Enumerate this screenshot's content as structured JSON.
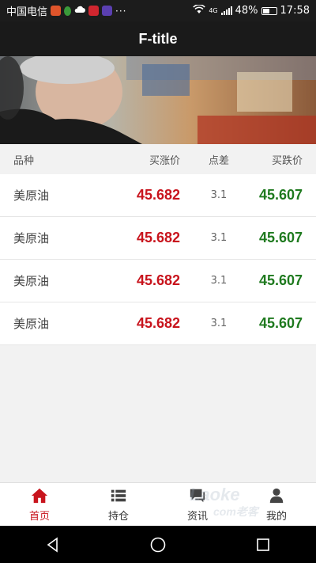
{
  "status_bar": {
    "carrier": "中国电信",
    "overflow_indicator": "···",
    "network": "4G",
    "battery": "48%",
    "battery_level": 0.48,
    "time": "17:58"
  },
  "header": {
    "title": "F-title"
  },
  "table": {
    "columns": [
      "品种",
      "买涨价",
      "点差",
      "买跌价"
    ],
    "rows": [
      {
        "name": "美原油",
        "buy": "45.682",
        "spread": "3.1",
        "sell": "45.607"
      },
      {
        "name": "美原油",
        "buy": "45.682",
        "spread": "3.1",
        "sell": "45.607"
      },
      {
        "name": "美原油",
        "buy": "45.682",
        "spread": "3.1",
        "sell": "45.607"
      },
      {
        "name": "美原油",
        "buy": "45.682",
        "spread": "3.1",
        "sell": "45.607"
      }
    ]
  },
  "tabs": [
    {
      "label": "首页",
      "icon": "home-icon",
      "active": true
    },
    {
      "label": "持仓",
      "icon": "list-icon",
      "active": false
    },
    {
      "label": "资讯",
      "icon": "chat-icon",
      "active": false
    },
    {
      "label": "我的",
      "icon": "user-icon",
      "active": false
    }
  ],
  "watermark": {
    "text": "Laoke",
    "subtext": "com老客"
  },
  "colors": {
    "rise": "#c8141d",
    "fall": "#1f7a1f",
    "header_bg": "#1a1a1a",
    "tab_active": "#c8141d"
  }
}
